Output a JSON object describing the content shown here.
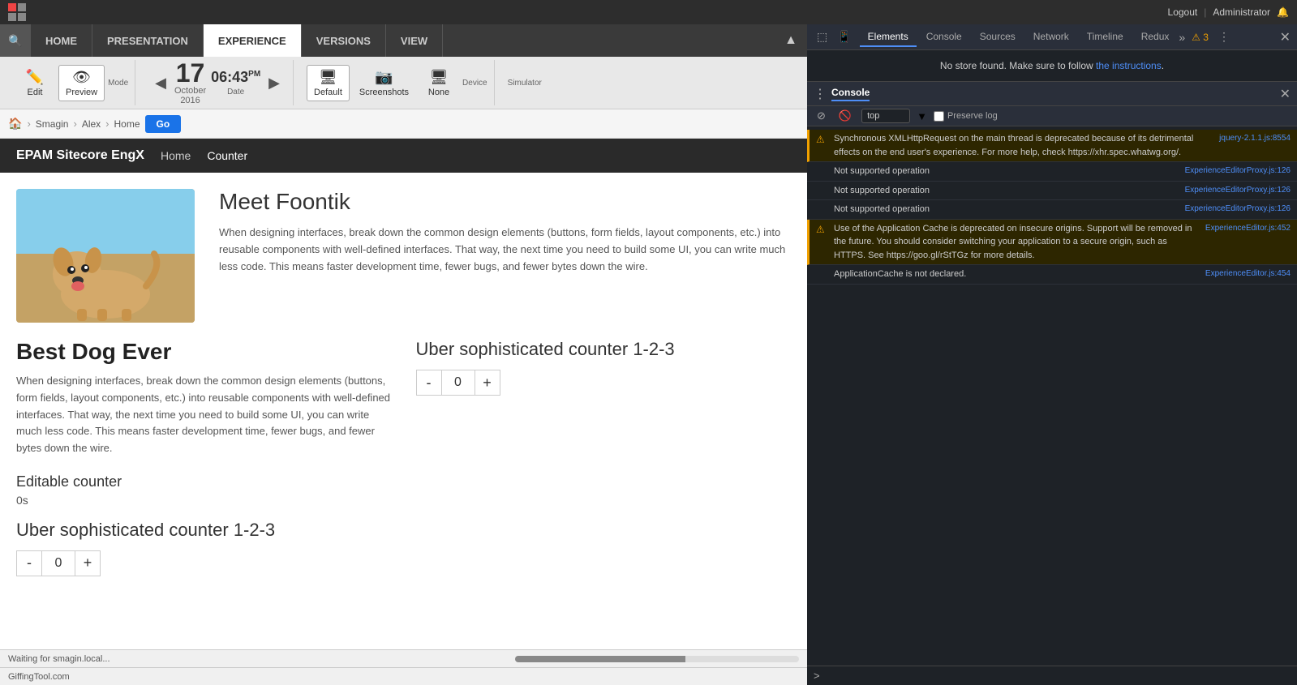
{
  "browser": {
    "grid_icon": "grid-icon",
    "logout_label": "Logout",
    "pipe": "|",
    "user_label": "Administrator",
    "user_icon": "👤"
  },
  "cms_nav": {
    "search_icon": "🔍",
    "items": [
      {
        "label": "HOME",
        "active": false
      },
      {
        "label": "PRESENTATION",
        "active": false
      },
      {
        "label": "EXPERIENCE",
        "active": true
      },
      {
        "label": "VERSIONS",
        "active": false
      },
      {
        "label": "VIEW",
        "active": false
      }
    ],
    "collapse_icon": "▲"
  },
  "toolbar": {
    "edit_label": "Edit",
    "edit_icon": "✏️",
    "preview_label": "Preview",
    "preview_icon": "👁",
    "date_prev": "◀",
    "date_day": "17",
    "date_month_year": "October\n2016",
    "date_time": "06:43",
    "date_ampm": "PM",
    "date_next": "▶",
    "date_label": "Date",
    "default_label": "Default",
    "default_icon": "🖥",
    "screenshots_label": "Screenshots",
    "screenshots_icon": "📷",
    "none_label": "None",
    "none_icon": "🖥",
    "simulator_label": "Simulator",
    "device_label": "Device"
  },
  "breadcrumb": {
    "home_icon": "🏠",
    "items": [
      "Smagin",
      "Alex",
      "Home"
    ],
    "go_label": "Go"
  },
  "site_nav": {
    "brand": "EPAM Sitecore EngX",
    "links": [
      "Home",
      "Counter"
    ]
  },
  "hero": {
    "title": "Meet Foontik",
    "description": "When designing interfaces, break down the common design elements (buttons, form fields, layout components, etc.) into reusable components with well-defined interfaces. That way, the next time you need to build some UI, you can write much less code. This means faster development time, fewer bugs, and fewer bytes down the wire."
  },
  "left_col": {
    "title": "Best Dog Ever",
    "text": "When designing interfaces, break down the common design elements (buttons, form fields, layout components, etc.) into reusable components with well-defined interfaces. That way, the next time you need to build some UI, you can write much less code. This means faster development time, fewer bugs, and fewer bytes down the wire.",
    "editable_counter_label": "Editable counter",
    "editable_counter_value": "0s",
    "sophisticated_title": "Uber sophisticated counter 1-2-3",
    "counter_minus": "-",
    "counter_value": "0",
    "counter_plus": "+"
  },
  "right_col": {
    "sophisticated_title": "Uber sophisticated counter 1-2-3",
    "counter_minus": "-",
    "counter_value": "0",
    "counter_plus": "+"
  },
  "status_bar": {
    "text": "Waiting for smagin.local...",
    "bottom_url": "GiffingTool.com"
  },
  "devtools": {
    "tabs": [
      "Elements",
      "Console",
      "Sources",
      "Network",
      "Timeline",
      "Redux"
    ],
    "active_tab": "Elements",
    "more_icon": "»",
    "warning_count": "⚠ 3",
    "more_options": "⋮",
    "close": "✕",
    "no_store_text": "No store found. Make sure to follow ",
    "instructions_link": "the instructions",
    "period": "."
  },
  "console": {
    "title": "Console",
    "close": "✕",
    "stop_icon": "⊘",
    "clear_icon": "🚫",
    "filter_placeholder": "top",
    "preserve_log": "Preserve log",
    "messages": [
      {
        "type": "warning",
        "text": "Synchronous XMLHttpRequest on the main thread is deprecated because of its detrimental effects on the end user's experience. For more help, check https://xhr.spec.whatwg.org/.",
        "link": "jquery-2.1.1.js:8554"
      },
      {
        "type": "info",
        "text": "Not supported operation",
        "link": "ExperienceEditorProxy.js:126"
      },
      {
        "type": "info",
        "text": "Not supported operation",
        "link": "ExperienceEditorProxy.js:126"
      },
      {
        "type": "info",
        "text": "Not supported operation",
        "link": "ExperienceEditorProxy.js:126"
      },
      {
        "type": "warning",
        "text": "Use of the Application Cache is deprecated on insecure origins. Support will be removed in the future. You should consider switching your application to a secure origin, such as HTTPS. See https://goo.gl/rStTGz for more details.",
        "link": "ExperienceEditor.js:452"
      },
      {
        "type": "info",
        "text": "ApplicationCache is not declared.",
        "link": "ExperienceEditor.js:454"
      }
    ],
    "prompt": ">"
  }
}
